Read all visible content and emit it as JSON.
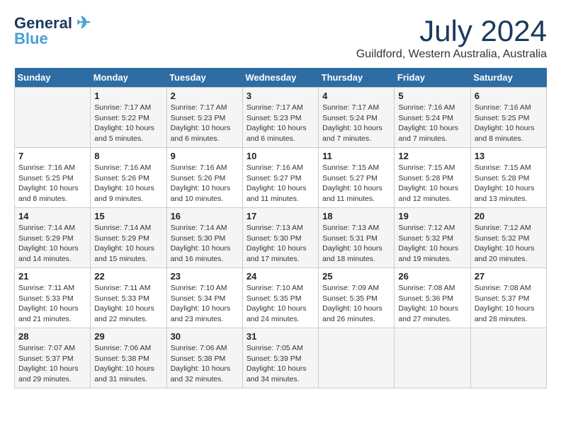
{
  "header": {
    "logo_line1": "General",
    "logo_line2": "Blue",
    "month_year": "July 2024",
    "location": "Guildford, Western Australia, Australia"
  },
  "weekdays": [
    "Sunday",
    "Monday",
    "Tuesday",
    "Wednesday",
    "Thursday",
    "Friday",
    "Saturday"
  ],
  "weeks": [
    [
      {
        "day": "",
        "sunrise": "",
        "sunset": "",
        "daylight": ""
      },
      {
        "day": "1",
        "sunrise": "Sunrise: 7:17 AM",
        "sunset": "Sunset: 5:22 PM",
        "daylight": "Daylight: 10 hours and 5 minutes."
      },
      {
        "day": "2",
        "sunrise": "Sunrise: 7:17 AM",
        "sunset": "Sunset: 5:23 PM",
        "daylight": "Daylight: 10 hours and 6 minutes."
      },
      {
        "day": "3",
        "sunrise": "Sunrise: 7:17 AM",
        "sunset": "Sunset: 5:23 PM",
        "daylight": "Daylight: 10 hours and 6 minutes."
      },
      {
        "day": "4",
        "sunrise": "Sunrise: 7:17 AM",
        "sunset": "Sunset: 5:24 PM",
        "daylight": "Daylight: 10 hours and 7 minutes."
      },
      {
        "day": "5",
        "sunrise": "Sunrise: 7:16 AM",
        "sunset": "Sunset: 5:24 PM",
        "daylight": "Daylight: 10 hours and 7 minutes."
      },
      {
        "day": "6",
        "sunrise": "Sunrise: 7:16 AM",
        "sunset": "Sunset: 5:25 PM",
        "daylight": "Daylight: 10 hours and 8 minutes."
      }
    ],
    [
      {
        "day": "7",
        "sunrise": "Sunrise: 7:16 AM",
        "sunset": "Sunset: 5:25 PM",
        "daylight": "Daylight: 10 hours and 8 minutes."
      },
      {
        "day": "8",
        "sunrise": "Sunrise: 7:16 AM",
        "sunset": "Sunset: 5:26 PM",
        "daylight": "Daylight: 10 hours and 9 minutes."
      },
      {
        "day": "9",
        "sunrise": "Sunrise: 7:16 AM",
        "sunset": "Sunset: 5:26 PM",
        "daylight": "Daylight: 10 hours and 10 minutes."
      },
      {
        "day": "10",
        "sunrise": "Sunrise: 7:16 AM",
        "sunset": "Sunset: 5:27 PM",
        "daylight": "Daylight: 10 hours and 11 minutes."
      },
      {
        "day": "11",
        "sunrise": "Sunrise: 7:15 AM",
        "sunset": "Sunset: 5:27 PM",
        "daylight": "Daylight: 10 hours and 11 minutes."
      },
      {
        "day": "12",
        "sunrise": "Sunrise: 7:15 AM",
        "sunset": "Sunset: 5:28 PM",
        "daylight": "Daylight: 10 hours and 12 minutes."
      },
      {
        "day": "13",
        "sunrise": "Sunrise: 7:15 AM",
        "sunset": "Sunset: 5:28 PM",
        "daylight": "Daylight: 10 hours and 13 minutes."
      }
    ],
    [
      {
        "day": "14",
        "sunrise": "Sunrise: 7:14 AM",
        "sunset": "Sunset: 5:29 PM",
        "daylight": "Daylight: 10 hours and 14 minutes."
      },
      {
        "day": "15",
        "sunrise": "Sunrise: 7:14 AM",
        "sunset": "Sunset: 5:29 PM",
        "daylight": "Daylight: 10 hours and 15 minutes."
      },
      {
        "day": "16",
        "sunrise": "Sunrise: 7:14 AM",
        "sunset": "Sunset: 5:30 PM",
        "daylight": "Daylight: 10 hours and 16 minutes."
      },
      {
        "day": "17",
        "sunrise": "Sunrise: 7:13 AM",
        "sunset": "Sunset: 5:30 PM",
        "daylight": "Daylight: 10 hours and 17 minutes."
      },
      {
        "day": "18",
        "sunrise": "Sunrise: 7:13 AM",
        "sunset": "Sunset: 5:31 PM",
        "daylight": "Daylight: 10 hours and 18 minutes."
      },
      {
        "day": "19",
        "sunrise": "Sunrise: 7:12 AM",
        "sunset": "Sunset: 5:32 PM",
        "daylight": "Daylight: 10 hours and 19 minutes."
      },
      {
        "day": "20",
        "sunrise": "Sunrise: 7:12 AM",
        "sunset": "Sunset: 5:32 PM",
        "daylight": "Daylight: 10 hours and 20 minutes."
      }
    ],
    [
      {
        "day": "21",
        "sunrise": "Sunrise: 7:11 AM",
        "sunset": "Sunset: 5:33 PM",
        "daylight": "Daylight: 10 hours and 21 minutes."
      },
      {
        "day": "22",
        "sunrise": "Sunrise: 7:11 AM",
        "sunset": "Sunset: 5:33 PM",
        "daylight": "Daylight: 10 hours and 22 minutes."
      },
      {
        "day": "23",
        "sunrise": "Sunrise: 7:10 AM",
        "sunset": "Sunset: 5:34 PM",
        "daylight": "Daylight: 10 hours and 23 minutes."
      },
      {
        "day": "24",
        "sunrise": "Sunrise: 7:10 AM",
        "sunset": "Sunset: 5:35 PM",
        "daylight": "Daylight: 10 hours and 24 minutes."
      },
      {
        "day": "25",
        "sunrise": "Sunrise: 7:09 AM",
        "sunset": "Sunset: 5:35 PM",
        "daylight": "Daylight: 10 hours and 26 minutes."
      },
      {
        "day": "26",
        "sunrise": "Sunrise: 7:08 AM",
        "sunset": "Sunset: 5:36 PM",
        "daylight": "Daylight: 10 hours and 27 minutes."
      },
      {
        "day": "27",
        "sunrise": "Sunrise: 7:08 AM",
        "sunset": "Sunset: 5:37 PM",
        "daylight": "Daylight: 10 hours and 28 minutes."
      }
    ],
    [
      {
        "day": "28",
        "sunrise": "Sunrise: 7:07 AM",
        "sunset": "Sunset: 5:37 PM",
        "daylight": "Daylight: 10 hours and 29 minutes."
      },
      {
        "day": "29",
        "sunrise": "Sunrise: 7:06 AM",
        "sunset": "Sunset: 5:38 PM",
        "daylight": "Daylight: 10 hours and 31 minutes."
      },
      {
        "day": "30",
        "sunrise": "Sunrise: 7:06 AM",
        "sunset": "Sunset: 5:38 PM",
        "daylight": "Daylight: 10 hours and 32 minutes."
      },
      {
        "day": "31",
        "sunrise": "Sunrise: 7:05 AM",
        "sunset": "Sunset: 5:39 PM",
        "daylight": "Daylight: 10 hours and 34 minutes."
      },
      {
        "day": "",
        "sunrise": "",
        "sunset": "",
        "daylight": ""
      },
      {
        "day": "",
        "sunrise": "",
        "sunset": "",
        "daylight": ""
      },
      {
        "day": "",
        "sunrise": "",
        "sunset": "",
        "daylight": ""
      }
    ]
  ]
}
